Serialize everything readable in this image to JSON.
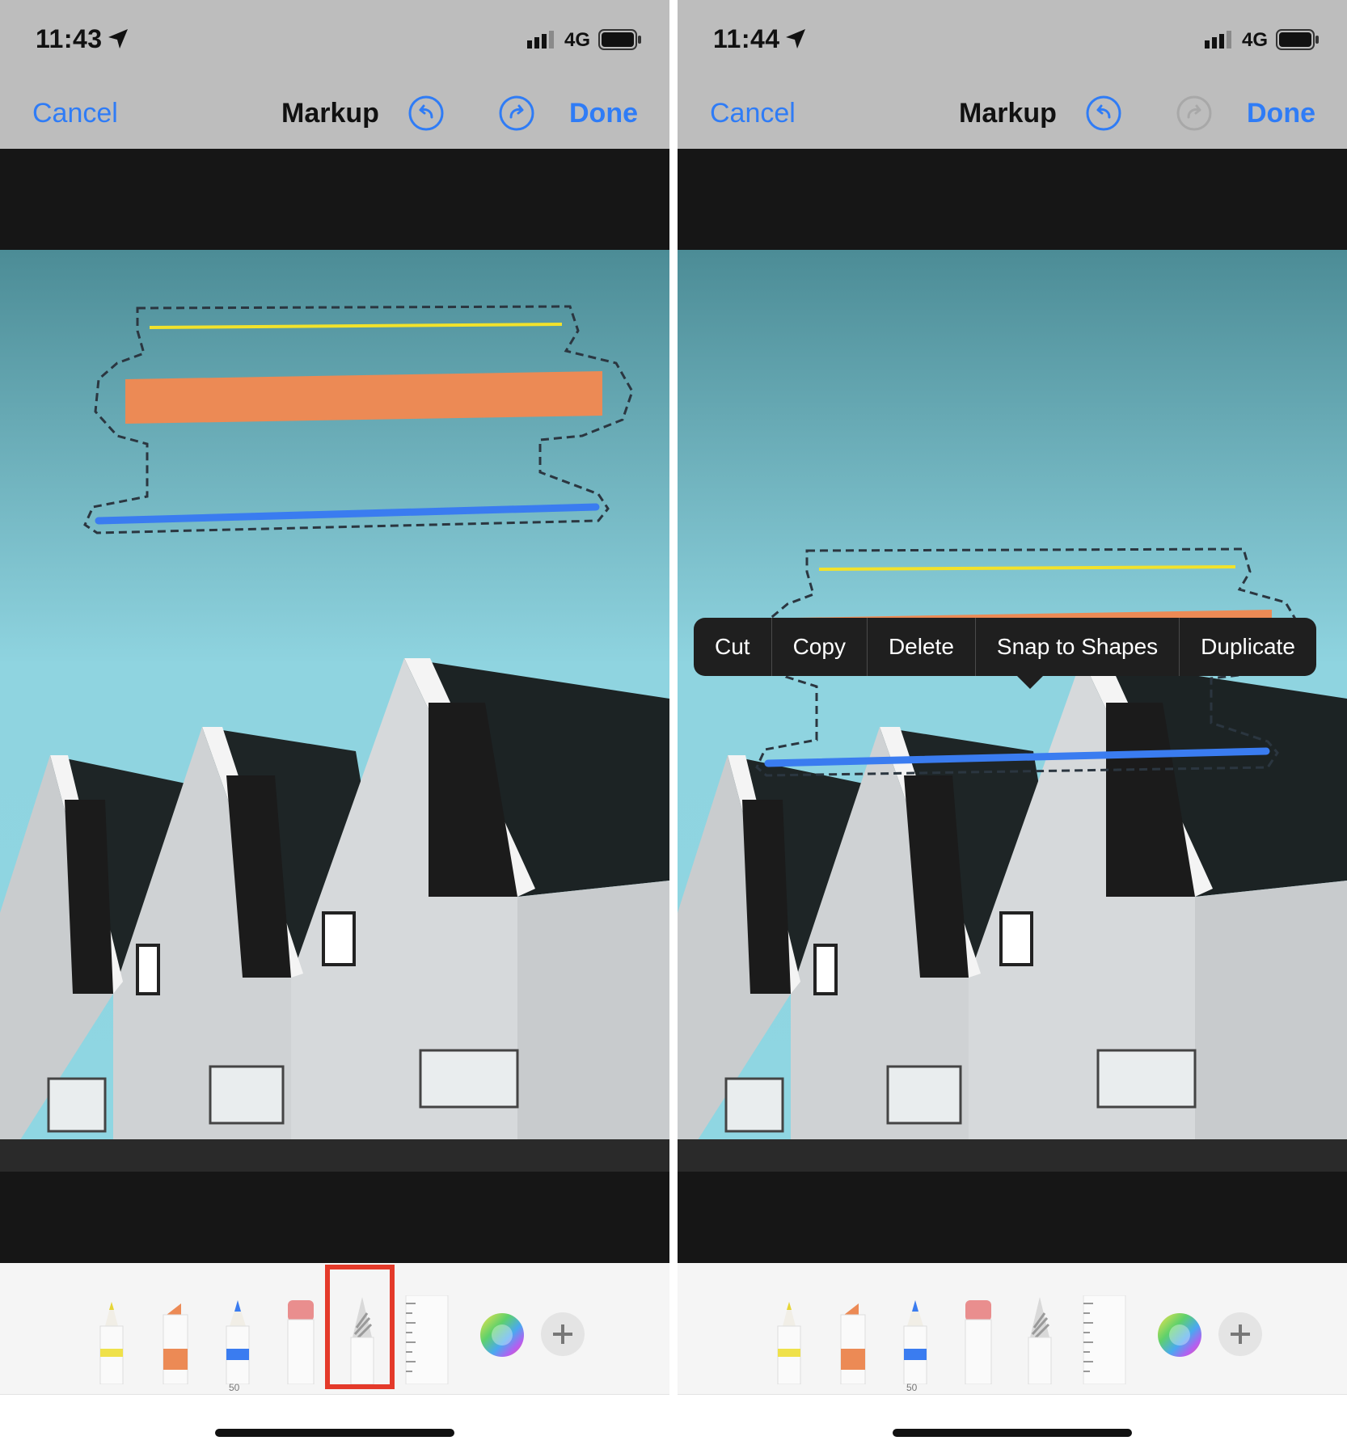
{
  "panels": [
    {
      "status": {
        "time": "11:43",
        "network": "4G"
      },
      "nav": {
        "cancel": "Cancel",
        "title": "Markup",
        "done": "Done",
        "redo_enabled": true
      },
      "tools": {
        "pen_size": "50",
        "selected_tool": "lasso"
      },
      "menu": null
    },
    {
      "status": {
        "time": "11:44",
        "network": "4G"
      },
      "nav": {
        "cancel": "Cancel",
        "title": "Markup",
        "done": "Done",
        "redo_enabled": false
      },
      "tools": {
        "pen_size": "50",
        "selected_tool": null
      },
      "menu": {
        "items": [
          "Cut",
          "Copy",
          "Delete",
          "Snap to Shapes",
          "Duplicate"
        ]
      }
    }
  ],
  "colors": {
    "accent": "#2f7cf6",
    "highlight": "#e43a2a",
    "stroke_yellow": "#f2e22b",
    "stroke_orange": "#ec8a55",
    "stroke_blue": "#3a7cf0"
  },
  "icons": [
    "location-arrow-icon",
    "signal-icon",
    "battery-icon",
    "undo-icon",
    "redo-icon",
    "pen-icon",
    "marker-icon",
    "pencil-icon",
    "eraser-icon",
    "lasso-icon",
    "ruler-icon",
    "color-picker-icon",
    "add-icon"
  ]
}
